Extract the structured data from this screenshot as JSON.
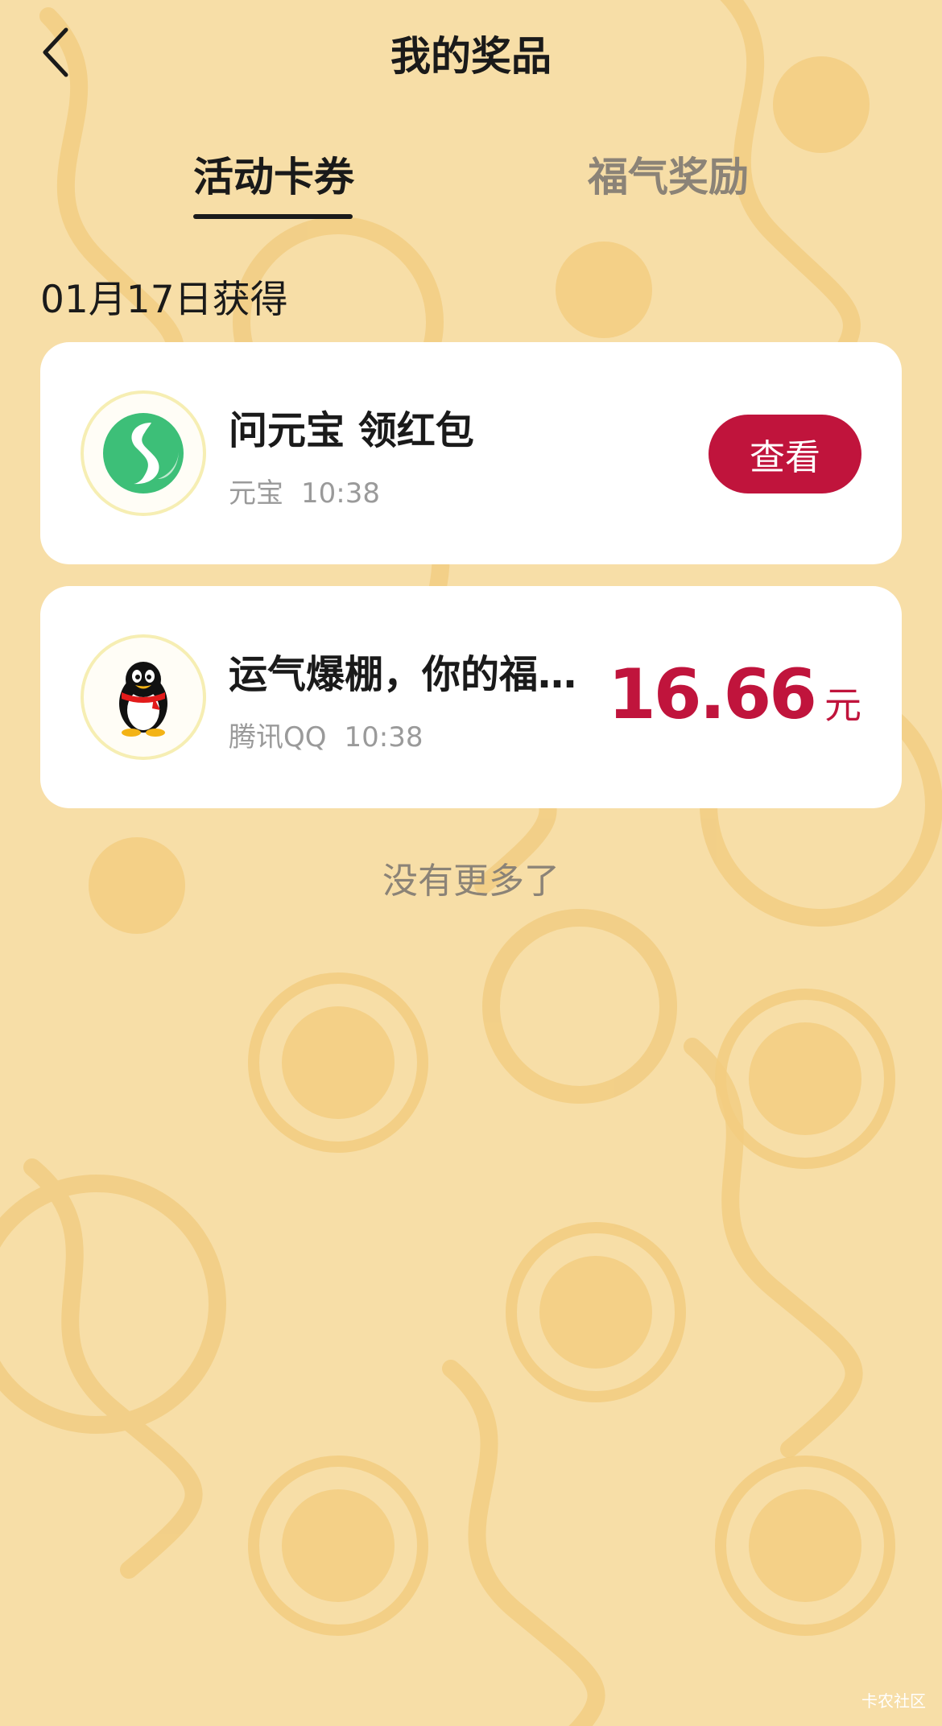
{
  "header": {
    "title": "我的奖品",
    "back_icon": "chevron-left-icon"
  },
  "tabs": [
    {
      "label": "活动卡券",
      "active": true
    },
    {
      "label": "福气奖励",
      "active": false
    }
  ],
  "section": {
    "date_label": "01月17日获得"
  },
  "prizes": [
    {
      "title": "问元宝 领红包",
      "source": "元宝",
      "time": "10:38",
      "icon": "yuanbao-logo-icon",
      "action_label": "查看"
    },
    {
      "title": "运气爆棚，你的福…",
      "source": "腾讯QQ",
      "time": "10:38",
      "icon": "qq-penguin-icon",
      "amount": "16.66",
      "amount_unit": "元"
    }
  ],
  "footer": {
    "no_more": "没有更多了"
  },
  "watermark": "卡农社区",
  "colors": {
    "background": "#f7dea7",
    "pattern": "#f2cc80",
    "accent": "#c0143c",
    "card": "#ffffff",
    "muted_text": "#8b8377"
  }
}
